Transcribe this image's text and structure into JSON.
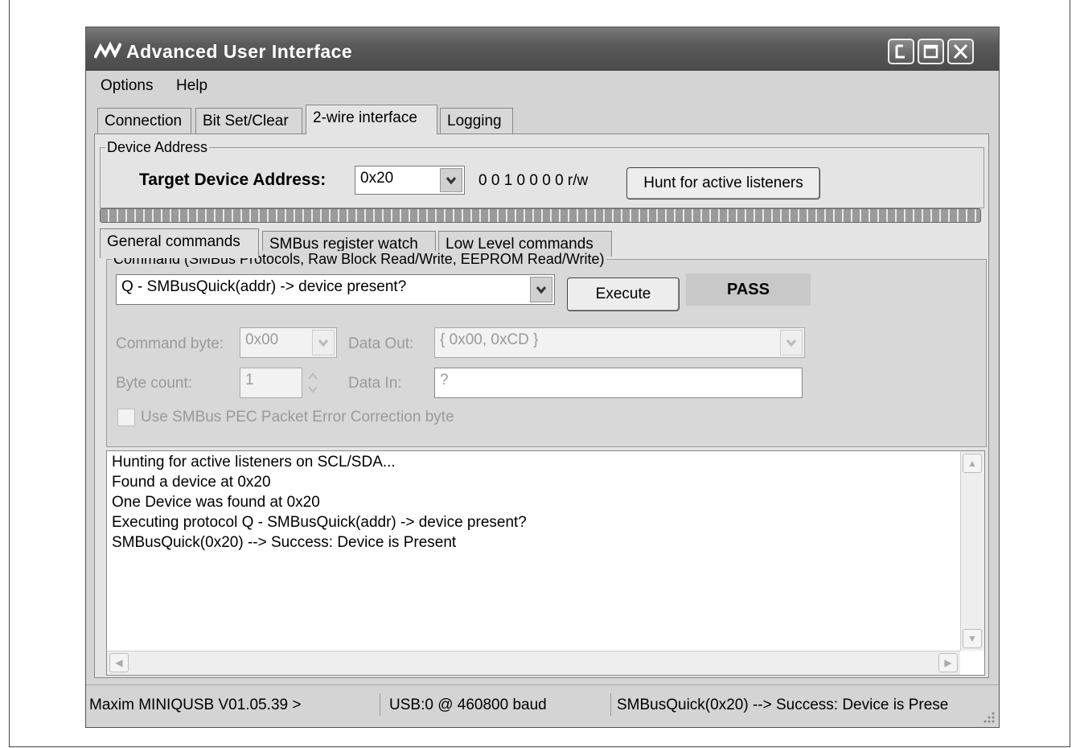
{
  "window": {
    "title": "Advanced User Interface"
  },
  "menu": {
    "options": "Options",
    "help": "Help"
  },
  "tabs": [
    "Connection",
    "Bit Set/Clear",
    "2-wire interface",
    "Logging"
  ],
  "device_address": {
    "legend": "Device Address",
    "target_label": "Target Device Address:",
    "address_value": "0x20",
    "binary": "0 0 1 0 0 0 0 r/w",
    "hunt_button": "Hunt for active listeners"
  },
  "subtabs": [
    "General commands",
    "SMBus register watch",
    "Low Level commands"
  ],
  "command": {
    "legend": "Command (SMBus Protocols, Raw Block Read/Write, EEPROM Read/Write)",
    "selected": "Q - SMBusQuick(addr) -> device present?",
    "execute_button": "Execute",
    "result": "PASS",
    "command_byte_label": "Command byte:",
    "command_byte_value": "0x00",
    "data_out_label": "Data Out:",
    "data_out_value": "{ 0x00, 0xCD }",
    "byte_count_label": "Byte count:",
    "byte_count_value": "1",
    "data_in_label": "Data In:",
    "data_in_value": "?",
    "pec_label": "Use SMBus PEC Packet Error Correction byte"
  },
  "log_lines": [
    "Hunting for active listeners on SCL/SDA...",
    "Found a device at 0x20",
    "One Device was found at 0x20",
    "Executing protocol Q - SMBusQuick(addr) -> device present?",
    "SMBusQuick(0x20) --> Success: Device is Present"
  ],
  "status": {
    "version": "Maxim MINIQUSB V01.05.39 >",
    "connection": "USB:0 @ 460800 baud",
    "message": "SMBusQuick(0x20) --> Success: Device is Prese"
  },
  "colors": {
    "titlebar": "#5a5a5a",
    "window_bg": "#d4d4d4",
    "panel_bg": "#e4e4e4"
  }
}
